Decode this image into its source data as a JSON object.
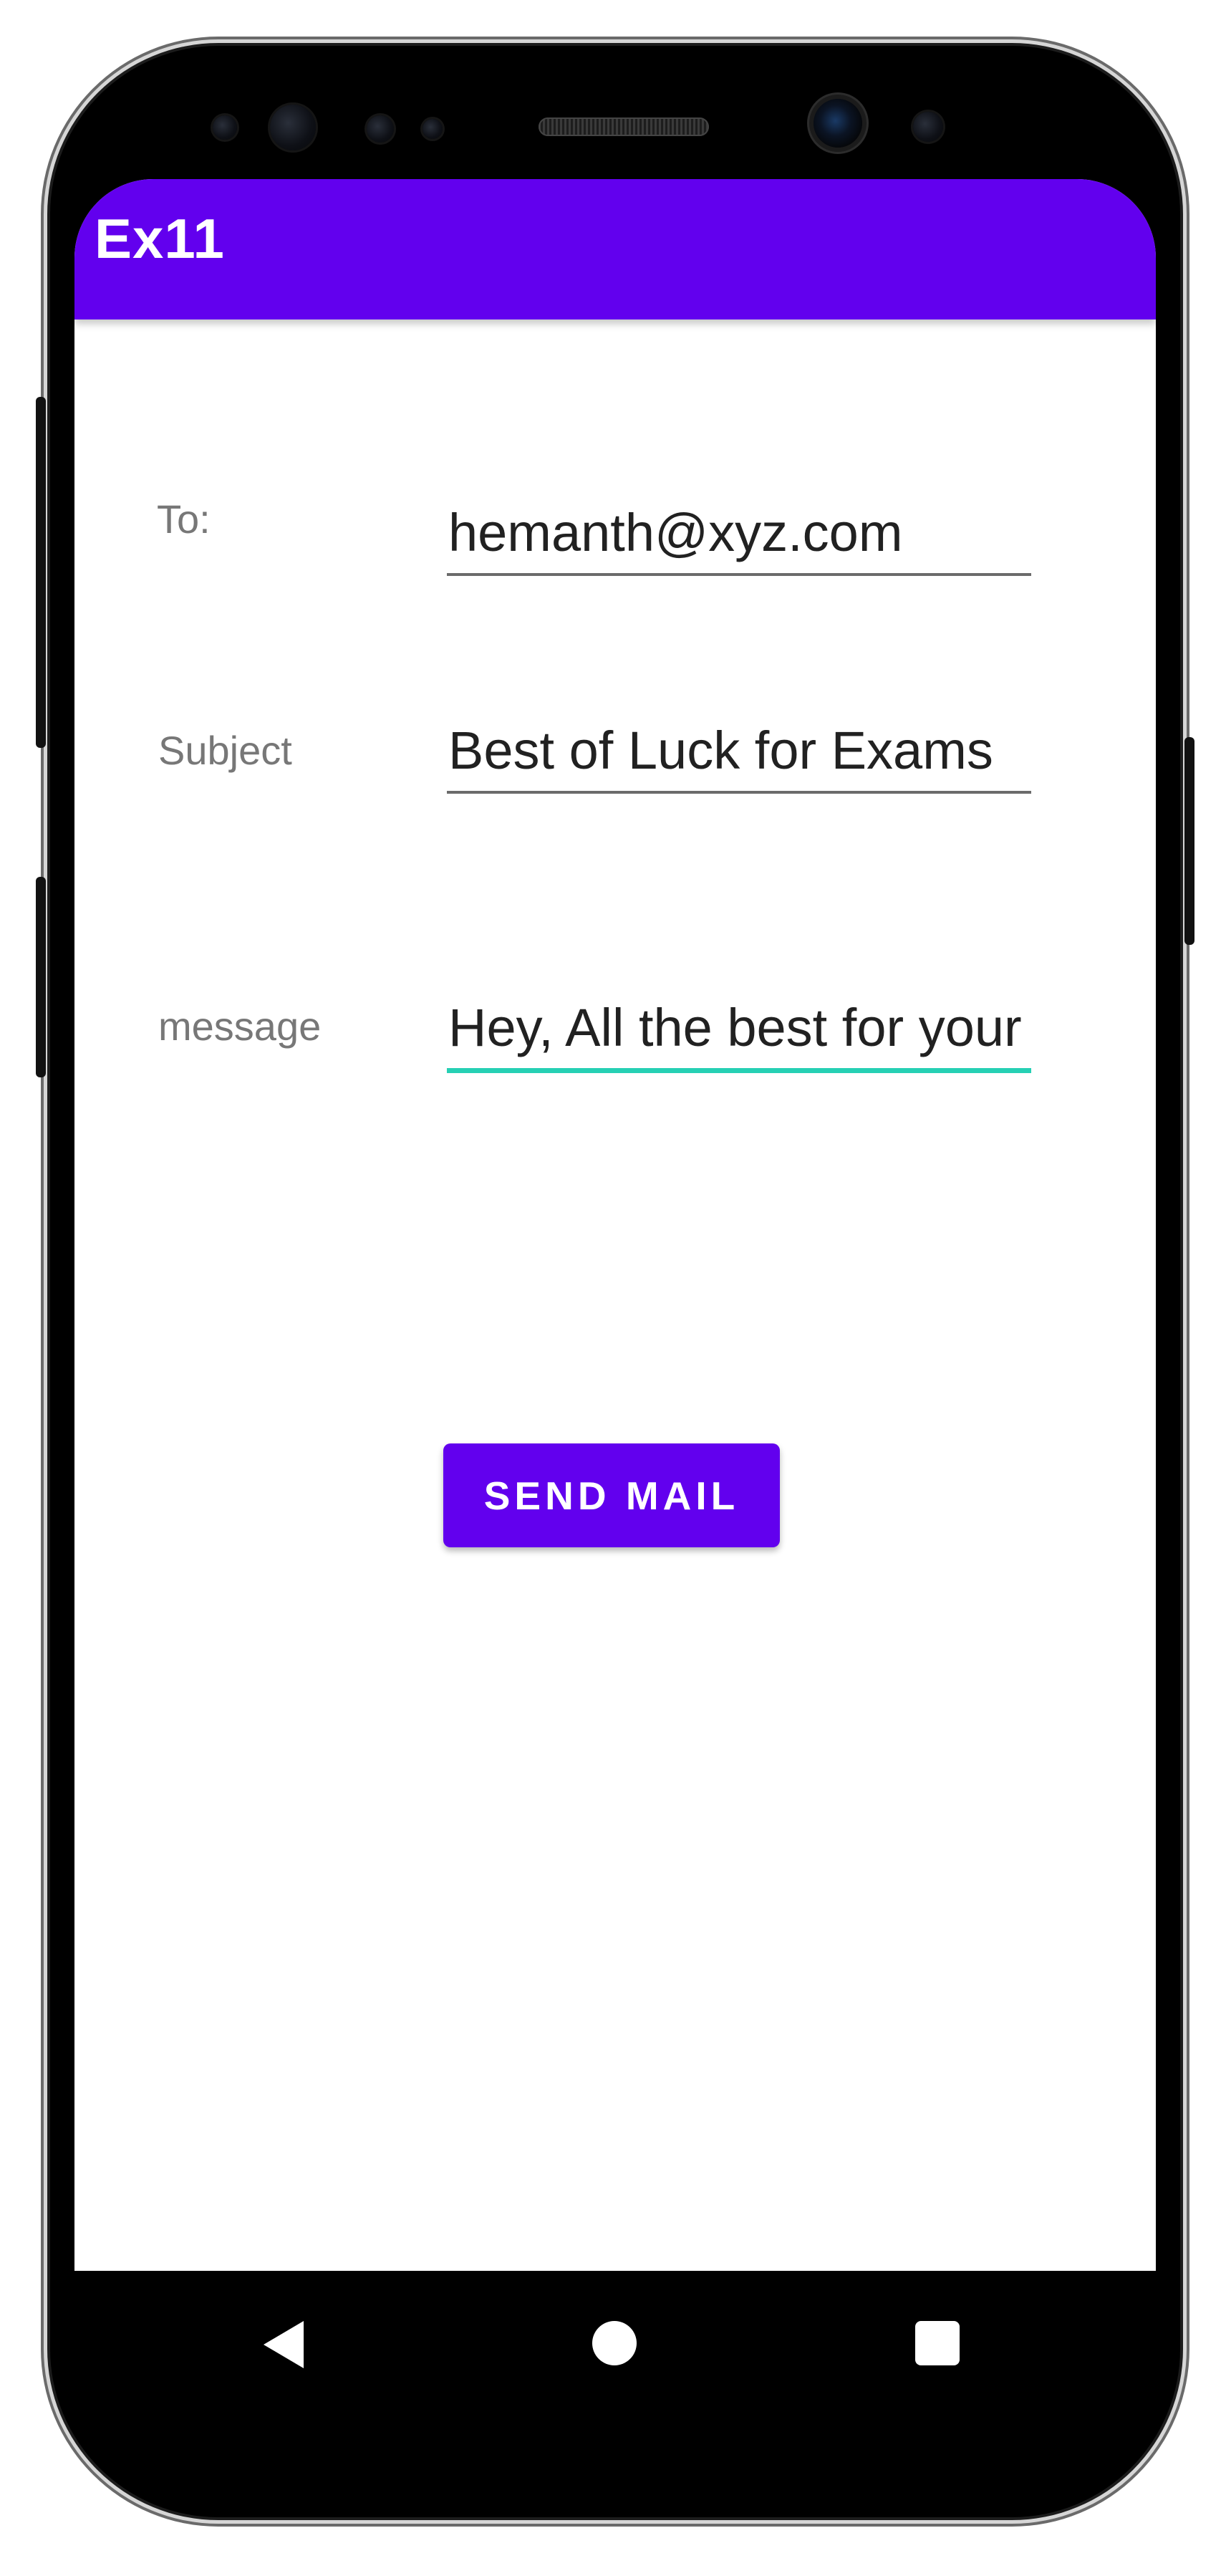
{
  "app_bar": {
    "title": "Ex11",
    "color": "#6200ee"
  },
  "form": {
    "to": {
      "label": "To:",
      "value": "hemanth@xyz.com"
    },
    "subject": {
      "label": "Subject",
      "value": "Best of Luck for Exams"
    },
    "message": {
      "label": "message",
      "value": "Hey, All the best for your Exams",
      "focused": true
    }
  },
  "send_button": {
    "label": "SEND MAIL"
  },
  "nav_bar": {
    "buttons": [
      "back-icon",
      "home-icon",
      "recents-icon"
    ]
  },
  "colors": {
    "accent": "#6200ee",
    "focus_underline": "#26d0b4"
  }
}
